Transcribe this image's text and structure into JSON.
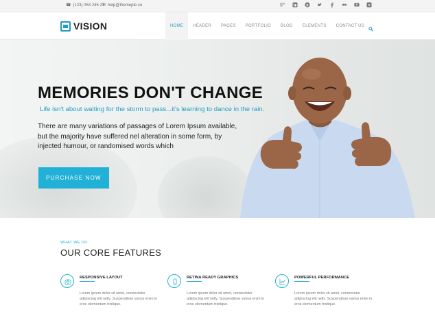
{
  "topbar": {
    "phone": "(123) 053 245 27",
    "email": "help@themeple.co",
    "social_icons": [
      "google-plus-icon",
      "linkedin-icon",
      "pinterest-icon",
      "twitter-icon",
      "facebook-icon",
      "flickr-icon",
      "youtube-icon",
      "skype-icon"
    ]
  },
  "header": {
    "logo_text": "VISION",
    "nav": [
      "HOME",
      "HEADER",
      "PAGES",
      "PORTFOLIO",
      "BLOG",
      "ELEMENTS",
      "CONTACT US"
    ],
    "active_nav": "HOME"
  },
  "hero": {
    "title": "MEMORIES DON'T CHANGE",
    "subtitle": "Life isn't about waiting for the storm to pass...it's learning to dance in the rain.",
    "body": "There are many variations of passages of Lorem Ipsum available, but the majority have suffered nel alteration in some form, by injected humour, or randomised words which",
    "button": "PURCHASE NOW"
  },
  "features": {
    "eyebrow": "WHAT WE DO",
    "heading": "OUR CORE FEATURES",
    "items": [
      {
        "title": "RESPONSIVE LAYOUT",
        "icon": "camera-icon",
        "desc": "Lorem ipsum dolor sit amet, consectetur adipiscing elit nelly. Suspendisse varius enim in eros elementum tristique."
      },
      {
        "title": "RETINA READY GRAPHICS",
        "icon": "phone-icon",
        "desc": "Lorem ipsum dolor sit amet, consectetur adipiscing elit nelly. Suspendisse varius enim in eros elementum tristique."
      },
      {
        "title": "POWERFUL PERFORMANCE",
        "icon": "chart-icon",
        "desc": "Lorem ipsum dolor sit amet, consectetur adipiscing elit nelly. Suspendisse varius enim in eros elementum tristique."
      }
    ]
  },
  "colors": {
    "accent": "#21b1d6",
    "logo": "#1f9cc4"
  }
}
